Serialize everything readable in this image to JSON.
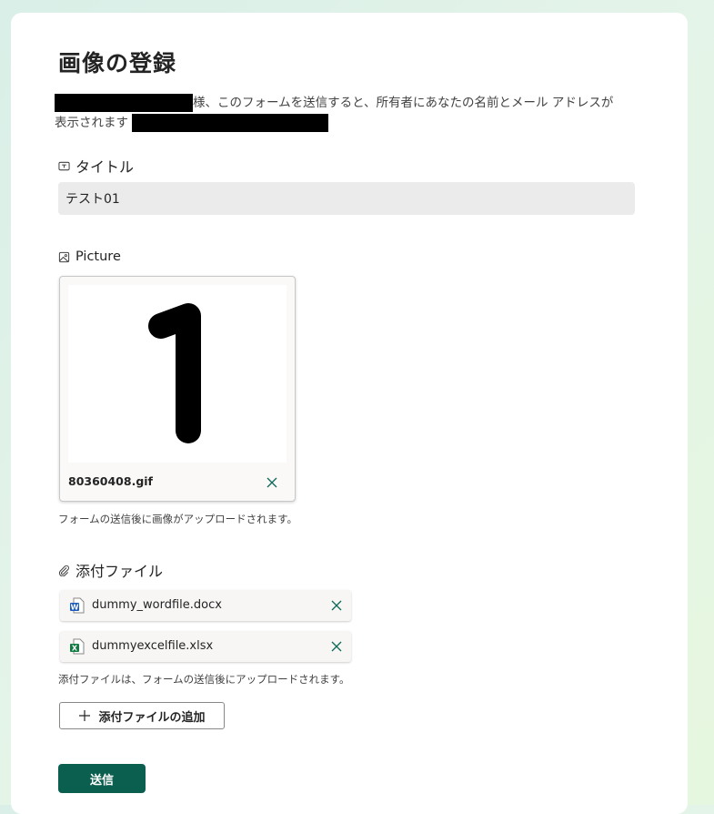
{
  "form": {
    "title": "画像の登録",
    "notice_line1": "様、このフォームを送信すると、所有者にあなたの名前とメール アドレスが",
    "notice_line2": "表示されます"
  },
  "fields": {
    "title_label": "タイトル",
    "title_value": "テスト01",
    "picture_label": "Picture",
    "picture_file": "80360408.gif",
    "picture_image_digit": "1",
    "picture_hint": "フォームの送信後に画像がアップロードされます。",
    "attachments_label": "添付ファイル",
    "attachments": [
      {
        "name": "dummy_wordfile.docx",
        "icon": "word-file-icon"
      },
      {
        "name": "dummyexcelfile.xlsx",
        "icon": "excel-file-icon"
      }
    ],
    "attachments_hint": "添付ファイルは、フォームの送信後にアップロードされます。",
    "add_attachment_label": "添付ファイルの追加"
  },
  "actions": {
    "submit_label": "送信"
  },
  "colors": {
    "accent": "#0b5f4f",
    "input_bg": "#ebebeb",
    "remove_icon": "#0b6a57",
    "word_blue": "#185abd",
    "excel_green": "#107c41"
  }
}
